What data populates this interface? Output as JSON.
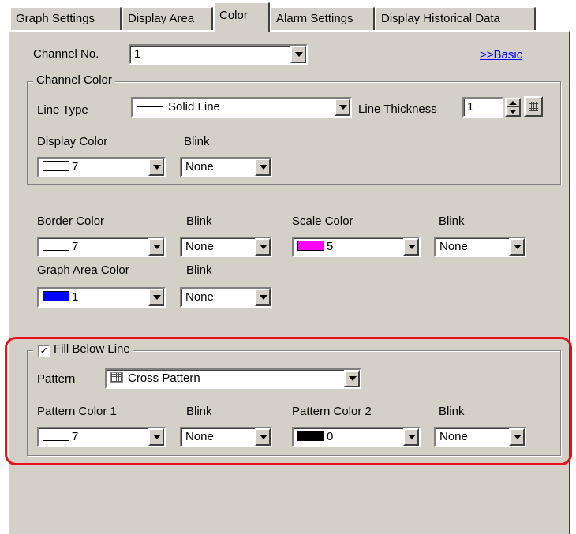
{
  "tabs": [
    {
      "label": "Graph Settings"
    },
    {
      "label": "Display Area"
    },
    {
      "label": "Color"
    },
    {
      "label": "Alarm Settings"
    },
    {
      "label": "Display Historical Data"
    }
  ],
  "channel": {
    "label": "Channel No.",
    "value": "1"
  },
  "basic_link": ">>Basic",
  "channel_color": {
    "legend": "Channel Color",
    "line_type_label": "Line Type",
    "line_type_value": "Solid Line",
    "line_thickness_label": "Line Thickness",
    "line_thickness_value": "1",
    "display_color_label": "Display Color",
    "display_color_value": "7",
    "blink_label": "Blink",
    "blink_value": "None"
  },
  "border_color": {
    "label": "Border Color",
    "value": "7"
  },
  "border_blink": {
    "label": "Blink",
    "value": "None"
  },
  "scale_color": {
    "label": "Scale Color",
    "value": "5"
  },
  "scale_blink": {
    "label": "Blink",
    "value": "None"
  },
  "graph_area_color": {
    "label": "Graph Area Color",
    "value": "1"
  },
  "graph_area_blink": {
    "label": "Blink",
    "value": "None"
  },
  "fill": {
    "checkbox_label": "Fill Below Line",
    "checked": true,
    "check_mark": "✓",
    "pattern_label": "Pattern",
    "pattern_value": "Cross Pattern",
    "color1_label": "Pattern Color 1",
    "color1_value": "7",
    "blink1_label": "Blink",
    "blink1_value": "None",
    "color2_label": "Pattern Color 2",
    "color2_value": "0",
    "blink2_label": "Blink",
    "blink2_value": "None"
  },
  "colors": {
    "color_7": "#ffffff",
    "color_5": "#ff00ff",
    "color_1": "#0000ff",
    "color_0": "#000000",
    "highlight": "#e8101a",
    "panel_bg": "#d4d0c8"
  }
}
